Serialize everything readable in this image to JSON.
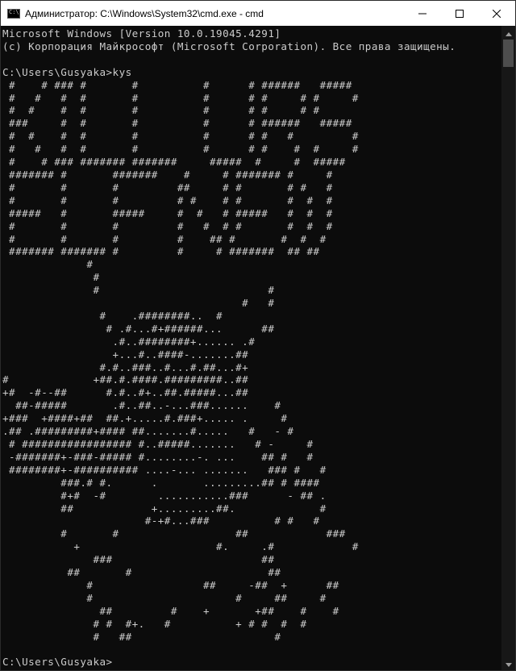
{
  "window": {
    "title": "Администратор: C:\\Windows\\System32\\cmd.exe - cmd",
    "icon": "cmd-icon"
  },
  "controls": {
    "minimize_icon": "minimize-icon",
    "maximize_icon": "maximize-icon",
    "close_icon": "close-icon"
  },
  "console": {
    "lines": [
      "Microsoft Windows [Version 10.0.19045.4291]",
      "(c) Корпорация Майкрософт (Microsoft Corporation). Все права защищены.",
      "",
      "C:\\Users\\Gusyaka>kys",
      " #    # ### #       #          #      # ######   #####",
      " #   #   #  #       #          #      # #     # #     #",
      " #  #    #  #       #          #      # #     # #",
      " ###     #  #       #          #      # ######   #####",
      " #  #    #  #       #          #      # #   #         #",
      " #   #   #  #       #          #      # #    #  #     #",
      " #    # ### ####### #######     #####  #     #  #####",
      " ####### #       #######    #     # ####### #     #",
      " #       #       #         ##     # #       # #   #",
      " #       #       #         # #    # #       #  #  #",
      " #####   #       #####     #  #   # #####   #  #  #",
      " #       #       #         #   #  # #       #  #  #",
      " #       #       #         #    ## #       #  #  #",
      " ####### ####### #         #     # #######  ## ##",
      "             #",
      "              #",
      "              #                          #",
      "                                     #   #",
      "               #    .########..  #",
      "                # .#...#+######...      ##",
      "                 .#..########+...... .#",
      "                 +...#..####-.......##",
      "               #.#..###..#...#.##...#+",
      "#             +##.#.####.#########..##",
      "+#  -#--##      #.#..#+..##.#####...##",
      "  ##-#####       .#..##..-...###......    #",
      "+###  +####+##  ##.+.....#.###+..... .     #",
      ".## .#########+#### ##.......#.....   #   - #",
      " # ################# #..#####.......   # -     #",
      " -#######+-###-##### #........-. ...    ## #   #",
      " ########+-########## ....-... .......   ### #   #",
      "         ###.# #.      .       .........## # ####",
      "         #+#  -#        ...........###      - ## .",
      "         ##            +.........##.             #",
      "                      #-+#...###          # #   #",
      "         #       #                  ##            ###",
      "           +                     #.     .#            #",
      "              ###                       ##",
      "          ##       #                     ##",
      "             #                 ##     -##  +      ##",
      "             #                      #     ##     #",
      "               ##         #    +       +##    #    #",
      "              # #  #+.   #          + # #  #  #",
      "              #   ##                      #",
      "",
      "C:\\Users\\Gusyaka>"
    ]
  }
}
